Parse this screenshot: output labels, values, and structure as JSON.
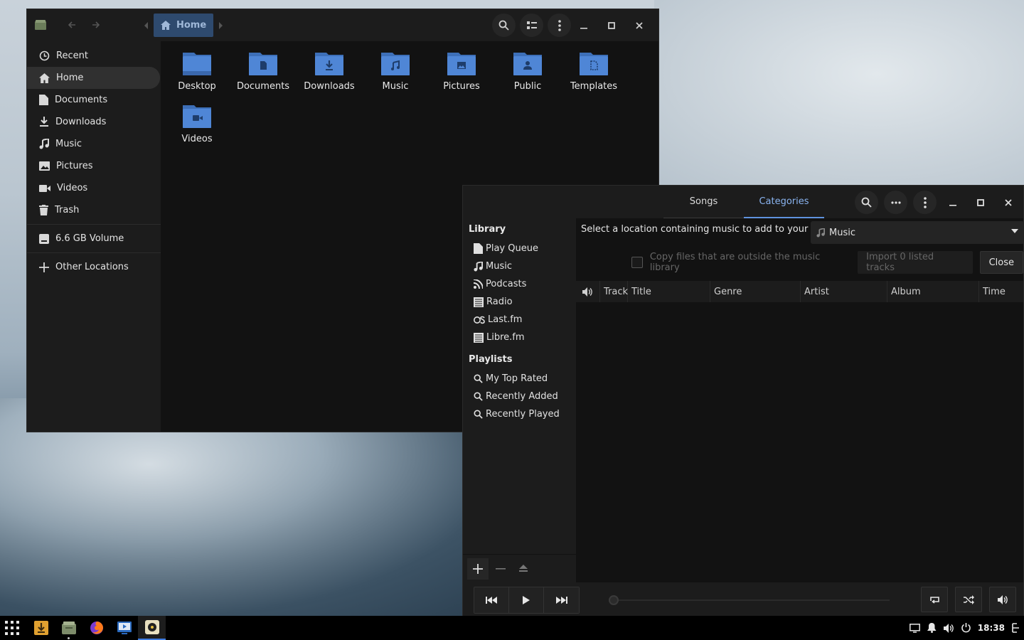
{
  "file_manager": {
    "breadcrumb": "Home",
    "sidebar": [
      {
        "label": "Recent",
        "icon": "clock-icon"
      },
      {
        "label": "Home",
        "icon": "home-icon",
        "selected": true
      },
      {
        "label": "Documents",
        "icon": "document-icon"
      },
      {
        "label": "Downloads",
        "icon": "download-icon"
      },
      {
        "label": "Music",
        "icon": "music-icon"
      },
      {
        "label": "Pictures",
        "icon": "picture-icon"
      },
      {
        "label": "Videos",
        "icon": "video-icon"
      },
      {
        "label": "Trash",
        "icon": "trash-icon"
      }
    ],
    "volume": "6.6 GB Volume",
    "other_locations": "Other Locations",
    "folders": [
      "Desktop",
      "Documents",
      "Downloads",
      "Music",
      "Pictures",
      "Public",
      "Templates",
      "Videos"
    ]
  },
  "music_player": {
    "tabs": [
      "Songs",
      "Categories"
    ],
    "active_tab": "Categories",
    "library_heading": "Library",
    "library_items": [
      "Play Queue",
      "Music",
      "Podcasts",
      "Radio",
      "Last.fm",
      "Libre.fm"
    ],
    "playlists_heading": "Playlists",
    "playlist_items": [
      "My Top Rated",
      "Recently Added",
      "Recently Played"
    ],
    "location_prompt": "Select a location containing music to add to your library:",
    "location_value": "Music",
    "copy_files_label": "Copy files that are outside the music library",
    "import_label": "Import 0 listed tracks",
    "close_label": "Close",
    "columns": [
      "Track",
      "Title",
      "Genre",
      "Artist",
      "Album",
      "Time"
    ]
  },
  "taskbar": {
    "time": "18:38"
  },
  "colors": {
    "accent": "#5f93de",
    "folder": "#4f86d6",
    "breadcrumb_bg": "#2e4a6e"
  }
}
